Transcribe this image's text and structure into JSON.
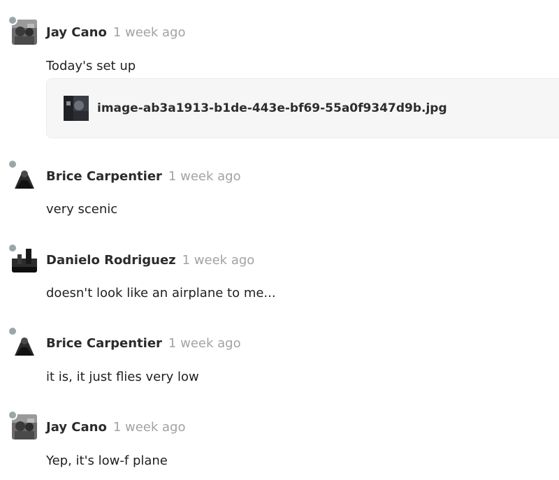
{
  "messages": [
    {
      "author": "Jay Cano",
      "time": "1 week ago",
      "text": "Today's set up",
      "avatar_icon": "avatar-jay-icon",
      "attachment": {
        "filename": "image-ab3a1913-b1de-443e-bf69-55a0f9347d9b.jpg",
        "icon": "image-thumbnail-icon"
      }
    },
    {
      "author": "Brice Carpentier",
      "time": "1 week ago",
      "text": "very scenic",
      "avatar_icon": "avatar-brice-icon"
    },
    {
      "author": "Danielo Rodriguez",
      "time": "1 week ago",
      "text": "doesn't look like an airplane to me...",
      "avatar_icon": "avatar-danielo-icon"
    },
    {
      "author": "Brice Carpentier",
      "time": "1 week ago",
      "text": "it is, it just flies very low",
      "avatar_icon": "avatar-brice-icon"
    },
    {
      "author": "Jay Cano",
      "time": "1 week ago",
      "text": "Yep, it's low-f plane",
      "avatar_icon": "avatar-jay-icon"
    }
  ],
  "colors": {
    "presence": "#9aa6a8",
    "author": "#2b2b2b",
    "timestamp": "#a2a2a2",
    "attachment_bg": "#f6f6f6"
  }
}
